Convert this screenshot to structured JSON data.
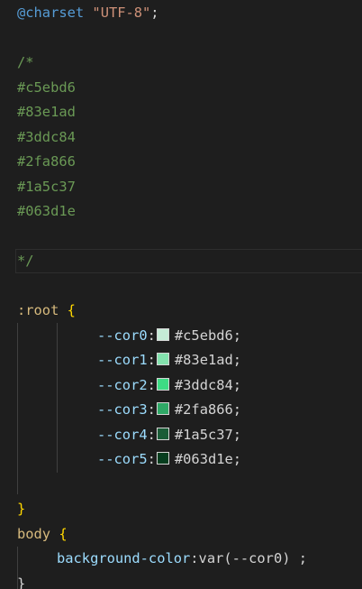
{
  "code": {
    "charset_keyword": "@charset",
    "charset_value": "\"UTF-8\"",
    "charset_end": ";",
    "comment_open": "/*",
    "comment_colors": [
      "#c5ebd6",
      "#83e1ad",
      "#3ddc84",
      "#2fa866",
      "#1a5c37",
      "#063d1e"
    ],
    "comment_close": "*/",
    "root_selector": ":root",
    "open_brace": "{",
    "close_brace": "}",
    "variables": [
      {
        "name": "--cor0",
        "colon": ":",
        "value": "#c5ebd6",
        "end": ";",
        "color": "#c5ebd6"
      },
      {
        "name": "--cor1",
        "colon": ":",
        "value": "#83e1ad",
        "end": ";",
        "color": "#83e1ad"
      },
      {
        "name": "--cor2",
        "colon": ":",
        "value": "#3ddc84",
        "end": ";",
        "color": "#3ddc84"
      },
      {
        "name": "--cor3",
        "colon": ":",
        "value": "#2fa866",
        "end": ";",
        "color": "#2fa866"
      },
      {
        "name": "--cor4",
        "colon": ":",
        "value": "#1a5c37",
        "end": ";",
        "color": "#1a5c37"
      },
      {
        "name": "--cor5",
        "colon": ":",
        "value": "#063d1e",
        "end": ";",
        "color": "#063d1e"
      }
    ],
    "body_selector": "body",
    "body_property": "background-color",
    "body_colon": ":",
    "body_value": "var(--cor0) ;"
  },
  "colors": {
    "background": "#1e1e1e",
    "comment": "#6a9955",
    "property": "#9cdcfe",
    "selector": "#d7ba7d",
    "keyword": "#569cd6",
    "string": "#ce9178",
    "brace": "#ffd700"
  }
}
